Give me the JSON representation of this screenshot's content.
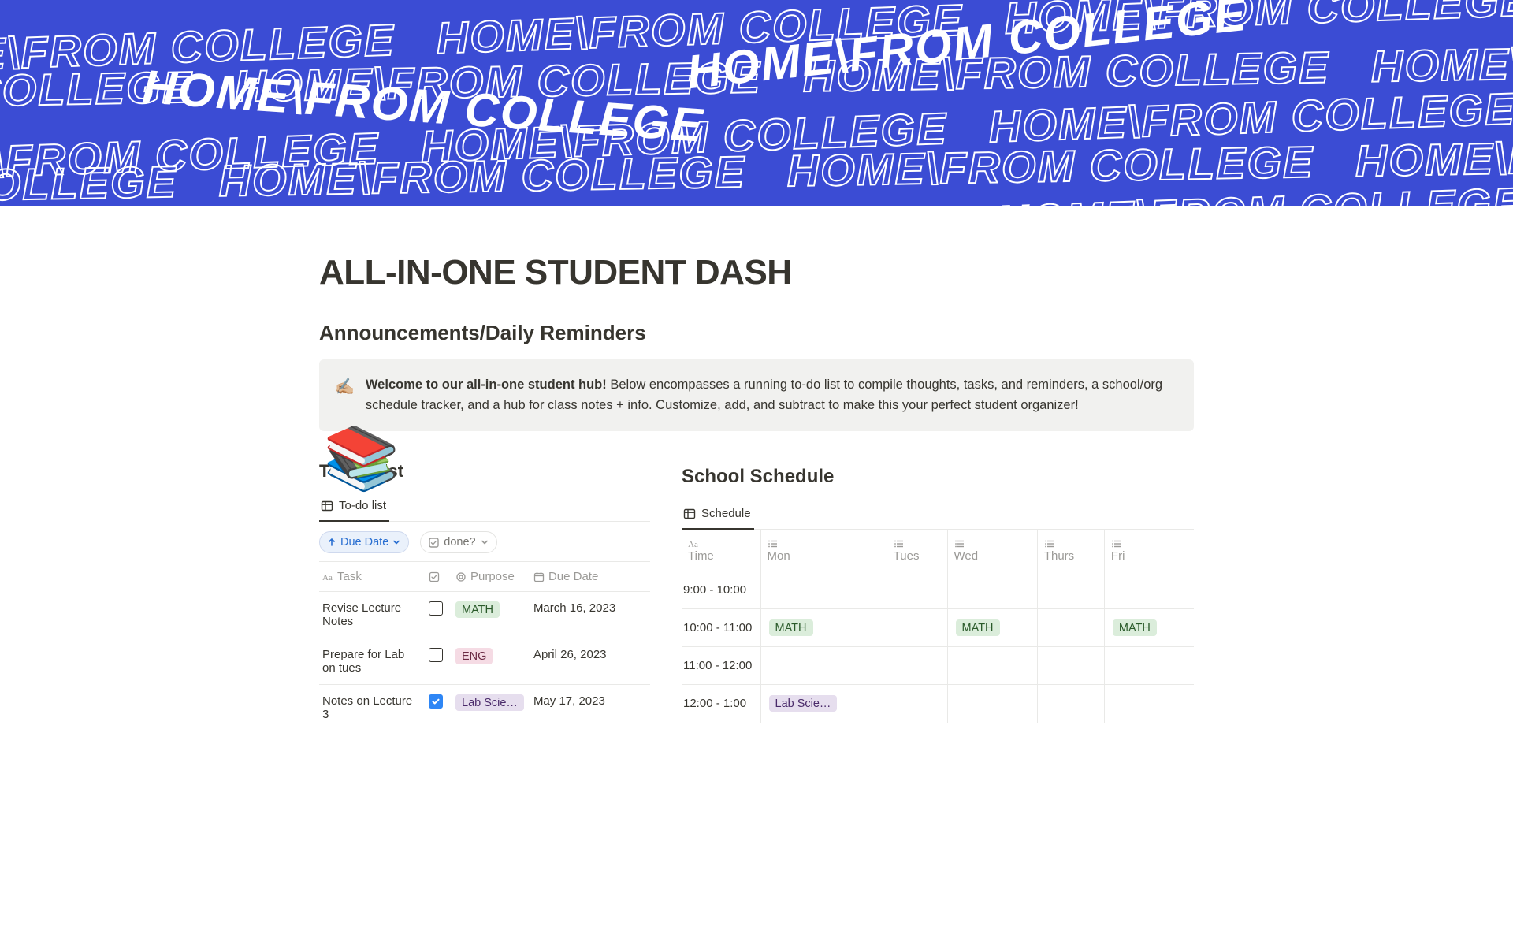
{
  "cover": {
    "repeat_text": "HOME\\FROM COLLEGE"
  },
  "page_icon": "📚",
  "page_title": "ALL-IN-ONE STUDENT DASH",
  "announcements": {
    "heading": "Announcements/Daily Reminders",
    "callout_icon": "✍🏼",
    "callout_bold": "Welcome to our all-in-one student hub!",
    "callout_rest": " Below encompasses a running to-do list to compile thoughts, tasks, and reminders, a school/org schedule tracker, and a hub for class notes + info. Customize, add, and subtract to make this your perfect student organizer!"
  },
  "todo": {
    "heading": "To-Do List",
    "tab_label": "To-do list",
    "sort_pill": "Due Date",
    "filter_pill": "done?",
    "columns": {
      "task": "Task",
      "done": "",
      "purpose": "Purpose",
      "due": "Due Date"
    },
    "rows": [
      {
        "task": "Revise Lecture Notes",
        "done": false,
        "purpose": "MATH",
        "purpose_color": "green",
        "due": "March 16, 2023"
      },
      {
        "task": "Prepare for Lab on tues",
        "done": false,
        "purpose": "ENG",
        "purpose_color": "pink",
        "due": "April 26, 2023"
      },
      {
        "task": "Notes on Lecture 3",
        "done": true,
        "purpose": "Lab Scie…",
        "purpose_color": "purple",
        "due": "May 17, 2023"
      }
    ]
  },
  "schedule": {
    "heading": "School Schedule",
    "tab_label": "Schedule",
    "columns": {
      "time": "Time",
      "mon": "Mon",
      "tues": "Tues",
      "wed": "Wed",
      "thurs": "Thurs",
      "fri": "Fri"
    },
    "rows": [
      {
        "time": "9:00 - 10:00",
        "mon": null,
        "tues": null,
        "wed": null,
        "thurs": null,
        "fri": null
      },
      {
        "time": "10:00 - 11:00",
        "mon": {
          "text": "MATH",
          "color": "green"
        },
        "tues": null,
        "wed": {
          "text": "MATH",
          "color": "green"
        },
        "thurs": null,
        "fri": {
          "text": "MATH",
          "color": "green"
        }
      },
      {
        "time": "11:00 - 12:00",
        "mon": null,
        "tues": null,
        "wed": null,
        "thurs": null,
        "fri": null
      },
      {
        "time": "12:00 - 1:00",
        "mon": {
          "text": "Lab Scie…",
          "color": "purple"
        },
        "tues": null,
        "wed": null,
        "thurs": null,
        "fri": null
      }
    ]
  }
}
